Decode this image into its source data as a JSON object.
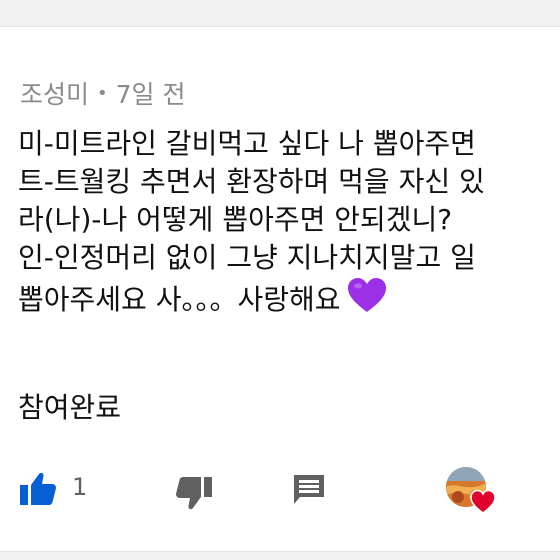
{
  "comment": {
    "author": "조성미",
    "separator": "•",
    "time_ago": "7일 전",
    "lines": [
      "미-미트라인 갈비먹고 싶다 나 뽑아주면",
      "트-트월킹 추면서 환장하며 먹을 자신 있",
      "라(나)-나 어떻게 뽑아주면 안되겠니?",
      "인-인정머리 없이 그냥 지나치지말고 일",
      "뽑아주세요 사。。。사랑해요"
    ],
    "emoji": "purple-heart-emoji",
    "completion": "참여완료"
  },
  "actions": {
    "like_count": "1",
    "like_icon": "thumbs-up-icon",
    "dislike_icon": "thumbs-down-icon",
    "reply_icon": "comment-icon",
    "creator_heart": "creator-heart-icon"
  },
  "colors": {
    "like_active": "#065fd4",
    "icon_gray": "#606060",
    "meta_gray": "#8a8a8a",
    "heart_red": "#e1002d",
    "emoji_purple": "#9b30e6"
  }
}
